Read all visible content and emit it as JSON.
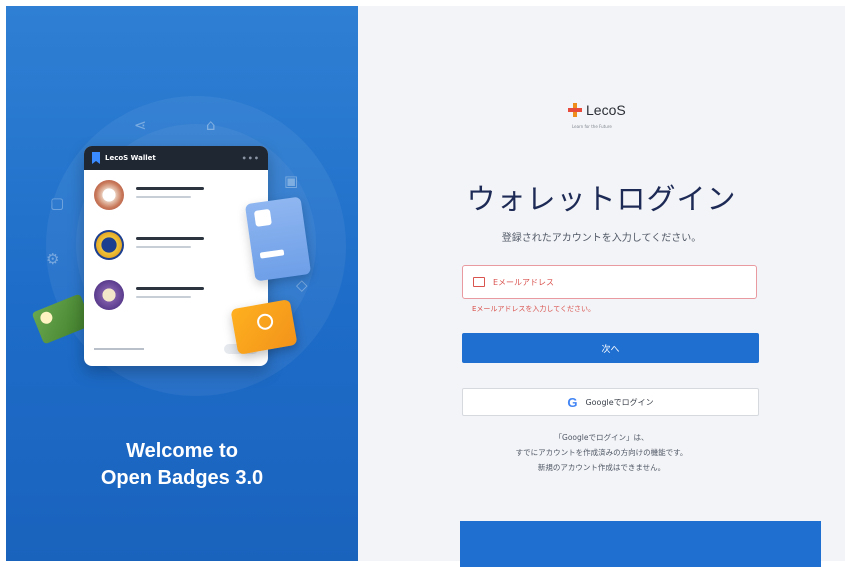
{
  "hero": {
    "wallet_title": "LecoS Wallet",
    "welcome_line1": "Welcome to",
    "welcome_line2": "Open Badges 3.0"
  },
  "brand": {
    "name": "LecoS",
    "tagline": "Learn for the Future"
  },
  "login": {
    "title": "ウォレットログイン",
    "subtitle": "登録されたアカウントを入力してください。",
    "email_placeholder": "Eメールアドレス",
    "email_error": "Eメールアドレスを入力してください。",
    "next_label": "次へ",
    "google_label": "Googleでログイン",
    "note_line1": "「Googleでログイン」は、",
    "note_line2": "すでにアカウントを作成済みの方向けの機能です。",
    "note_line3": "新規のアカウント作成はできません。"
  },
  "colors": {
    "left_panel": "#1f6fd1",
    "primary_button": "#1f6fd1",
    "error": "#d9534f",
    "title": "#1d2a55",
    "right_bg": "#f3f4f7"
  }
}
